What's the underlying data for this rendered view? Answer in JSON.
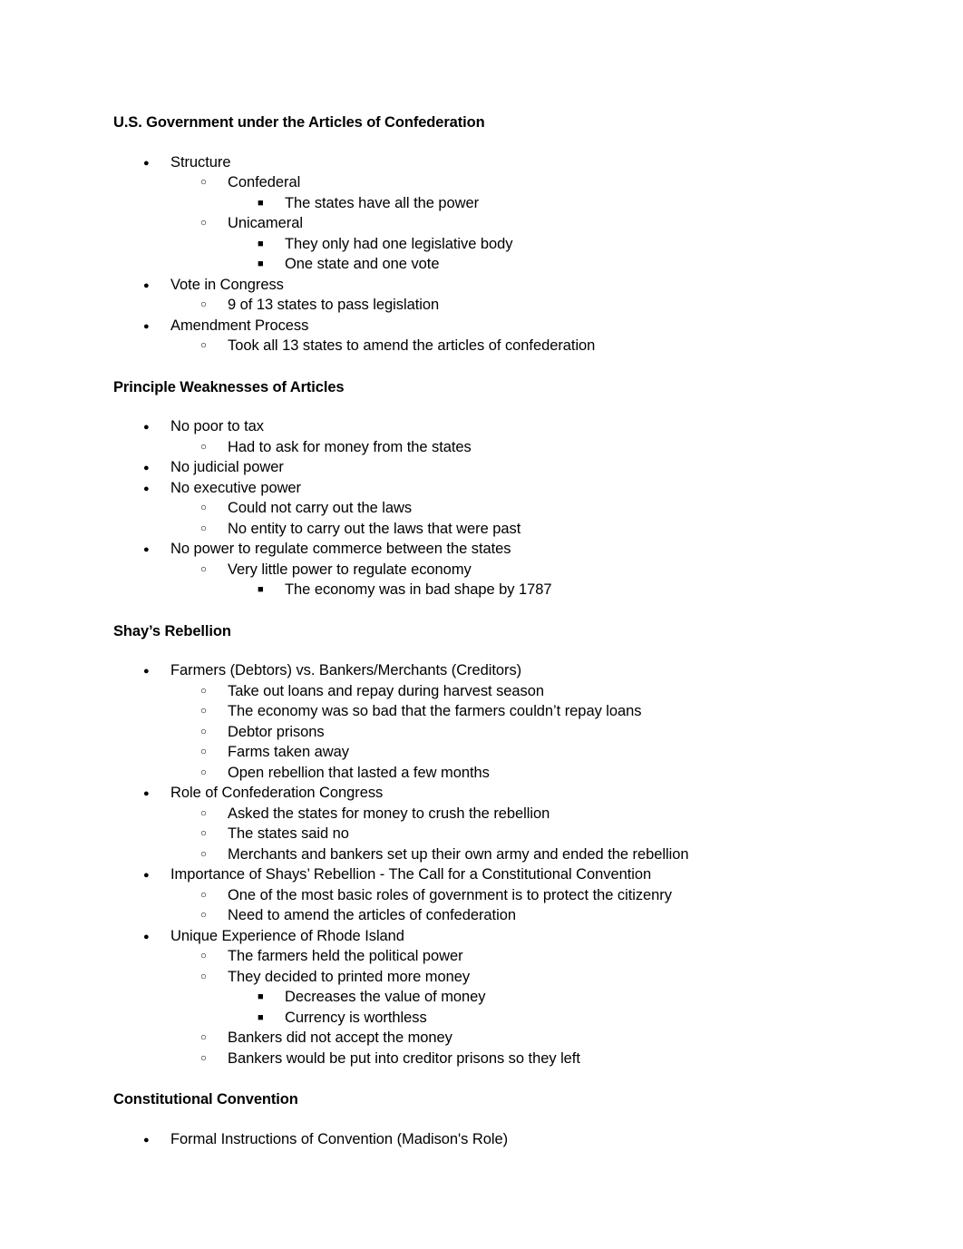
{
  "document": {
    "sections": [
      {
        "heading": "U.S. Government under the Articles of Confederation",
        "items": [
          {
            "level": 1,
            "text": "Structure"
          },
          {
            "level": 2,
            "text": "Confederal"
          },
          {
            "level": 3,
            "text": "The states have all the power"
          },
          {
            "level": 2,
            "text": "Unicameral"
          },
          {
            "level": 3,
            "text": "They only had one legislative body"
          },
          {
            "level": 3,
            "text": "One state and one vote"
          },
          {
            "level": 1,
            "text": "Vote in Congress"
          },
          {
            "level": 2,
            "text": "9 of 13 states to pass legislation"
          },
          {
            "level": 1,
            "text": "Amendment Process"
          },
          {
            "level": 2,
            "text": "Took all 13 states to amend the articles of confederation"
          }
        ]
      },
      {
        "heading": "Principle Weaknesses of Articles",
        "items": [
          {
            "level": 1,
            "text": "No poor to tax"
          },
          {
            "level": 2,
            "text": "Had to ask for money from the states"
          },
          {
            "level": 1,
            "text": "No judicial power"
          },
          {
            "level": 1,
            "text": "No executive power"
          },
          {
            "level": 2,
            "text": "Could not carry out the laws"
          },
          {
            "level": 2,
            "text": "No entity to carry out the laws that were past"
          },
          {
            "level": 1,
            "text": "No power to regulate commerce between the states"
          },
          {
            "level": 2,
            "text": "Very little power to regulate economy"
          },
          {
            "level": 3,
            "text": "The economy was in bad shape by 1787"
          }
        ]
      },
      {
        "heading": "Shay’s Rebellion",
        "items": [
          {
            "level": 1,
            "text": "Farmers (Debtors) vs. Bankers/Merchants (Creditors)"
          },
          {
            "level": 2,
            "text": "Take out loans and repay during harvest season"
          },
          {
            "level": 2,
            "text": "The economy was so bad that the farmers couldn’t repay loans"
          },
          {
            "level": 2,
            "text": "Debtor prisons"
          },
          {
            "level": 2,
            "text": "Farms taken away"
          },
          {
            "level": 2,
            "text": "Open rebellion that lasted a few months"
          },
          {
            "level": 1,
            "text": "Role of Confederation Congress"
          },
          {
            "level": 2,
            "text": "Asked the states for money to crush the rebellion"
          },
          {
            "level": 2,
            "text": "The states said no"
          },
          {
            "level": 2,
            "text": "Merchants and bankers set up their own army and ended the rebellion"
          },
          {
            "level": 1,
            "text": "Importance of Shays’ Rebellion - The Call for a Constitutional Convention"
          },
          {
            "level": 2,
            "text": "One of the most basic roles of government is to protect the citizenry"
          },
          {
            "level": 2,
            "text": "Need to amend the articles of confederation"
          },
          {
            "level": 1,
            "text": "Unique Experience of Rhode Island"
          },
          {
            "level": 2,
            "text": "The farmers held the political power"
          },
          {
            "level": 2,
            "text": "They decided to printed more money"
          },
          {
            "level": 3,
            "text": "Decreases the value of money"
          },
          {
            "level": 3,
            "text": "Currency is worthless"
          },
          {
            "level": 2,
            "text": "Bankers did not accept the money"
          },
          {
            "level": 2,
            "text": "Bankers would be put into creditor prisons so they left"
          }
        ]
      },
      {
        "heading": "Constitutional Convention",
        "items": [
          {
            "level": 1,
            "text": "Formal Instructions of Convention (Madison's Role)"
          }
        ]
      }
    ]
  }
}
